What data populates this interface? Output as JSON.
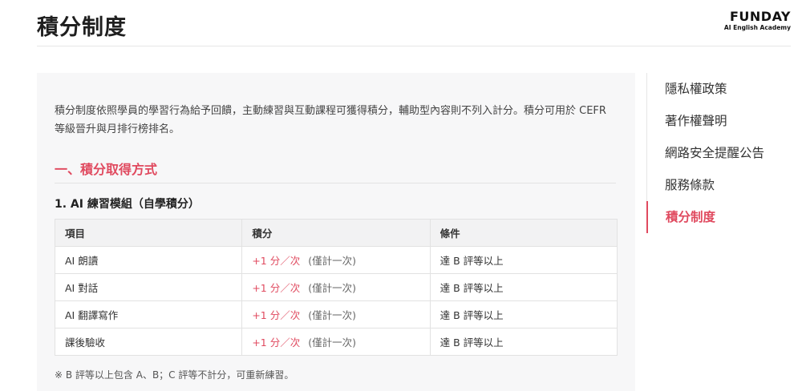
{
  "header": {
    "title": "積分制度",
    "logo_main": "FUNDAY",
    "logo_sub": "AI English Academy"
  },
  "content": {
    "intro": "積分制度依照學員的學習行為給予回饋，主動練習與互動課程可獲得積分，輔助型內容則不列入計分。積分可用於 CEFR 等級晉升與月排行榜排名。",
    "section_title": "一、積分取得方式",
    "sub_title": "1. AI 練習模組（自學積分）",
    "table": {
      "headers": [
        "項目",
        "積分",
        "條件"
      ],
      "rows": [
        {
          "item": "AI 朗讀",
          "points": "+1 分／次",
          "note": "(僅計一次)",
          "condition": "達 B 評等以上"
        },
        {
          "item": "AI 對話",
          "points": "+1 分／次",
          "note": "(僅計一次)",
          "condition": "達 B 評等以上"
        },
        {
          "item": "AI 翻譯寫作",
          "points": "+1 分／次",
          "note": "(僅計一次)",
          "condition": "達 B 評等以上"
        },
        {
          "item": "課後驗收",
          "points": "+1 分／次",
          "note": "(僅計一次)",
          "condition": "達 B 評等以上"
        }
      ]
    },
    "footnote": "※ B 評等以上包含 A、B；C 評等不計分，可重新練習。"
  },
  "side_nav": {
    "items": [
      {
        "label": "隱私權政策"
      },
      {
        "label": "著作權聲明"
      },
      {
        "label": "網路安全提醒公告"
      },
      {
        "label": "服務條款"
      },
      {
        "label": "積分制度"
      }
    ],
    "active_index": 4
  },
  "colors": {
    "accent": "#e04a5f",
    "panel_bg": "#f7f7f8"
  }
}
